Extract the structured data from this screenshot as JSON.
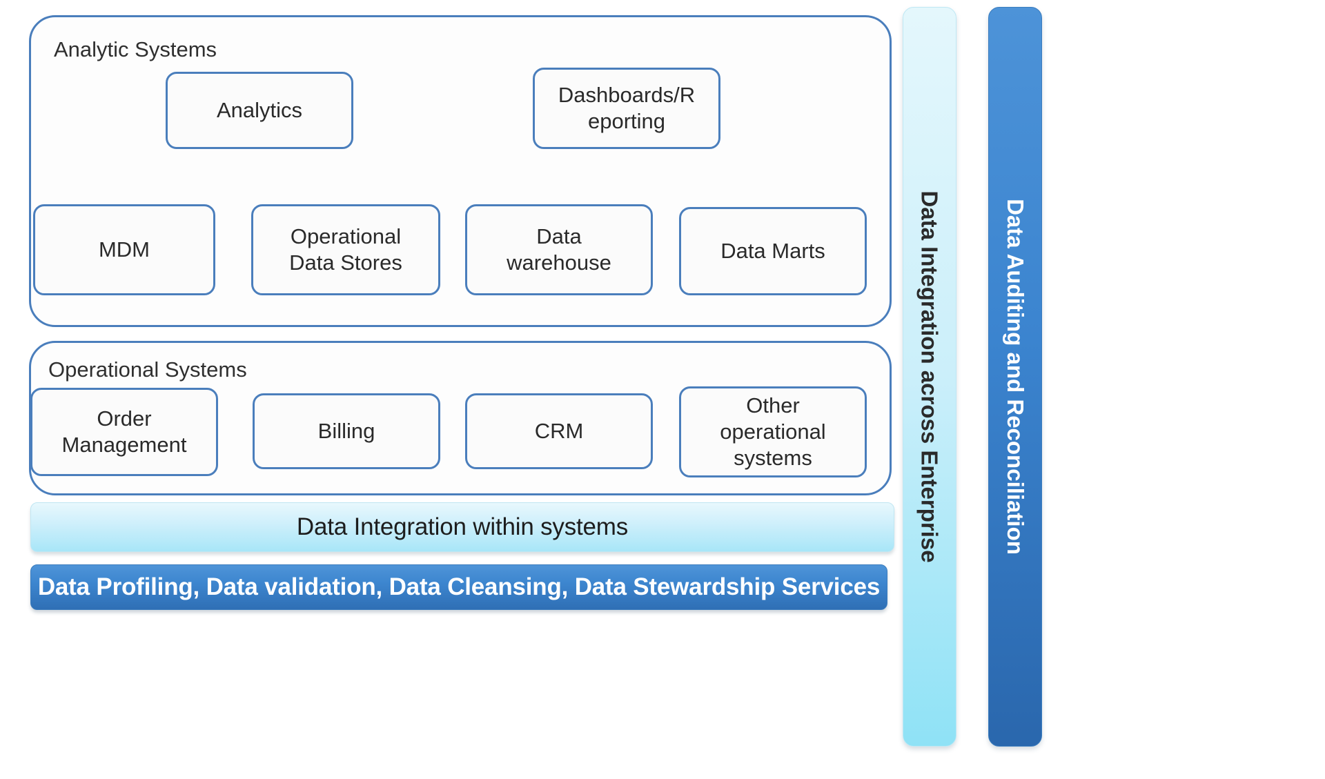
{
  "diagram": {
    "analytic_systems": {
      "title": "Analytic Systems",
      "nodes": {
        "analytics": "Analytics",
        "dashboards_reporting": "Dashboards/R\neporting",
        "mdm": "MDM",
        "operational_data_stores": "Operational\nData Stores",
        "data_warehouse": "Data\nwarehouse",
        "data_marts": "Data Marts"
      }
    },
    "operational_systems": {
      "title": "Operational Systems",
      "nodes": {
        "order_management": "Order\nManagement",
        "billing": "Billing",
        "crm": "CRM",
        "other_operational_systems": "Other\noperational\nsystems"
      }
    },
    "bars": {
      "data_integration_within_systems": "Data Integration within systems",
      "data_profiling_services": "Data Profiling, Data validation, Data Cleansing,  Data Stewardship Services",
      "data_integration_across_enterprise": "Data Integration across Enterprise",
      "data_auditing_and_reconciliation": "Data Auditing and Reconciliation"
    },
    "colors": {
      "border_blue": "#4a7ebc",
      "light_blue_bar": "#a8e6f8",
      "dark_blue_bar": "#3d86cf",
      "vertical_light_bar": "#8fe2f6",
      "vertical_dark_bar": "#3b84cf",
      "node_fill": "#fbfbfb",
      "text_dark": "#2a2a2a",
      "text_light": "#ffffff"
    }
  }
}
